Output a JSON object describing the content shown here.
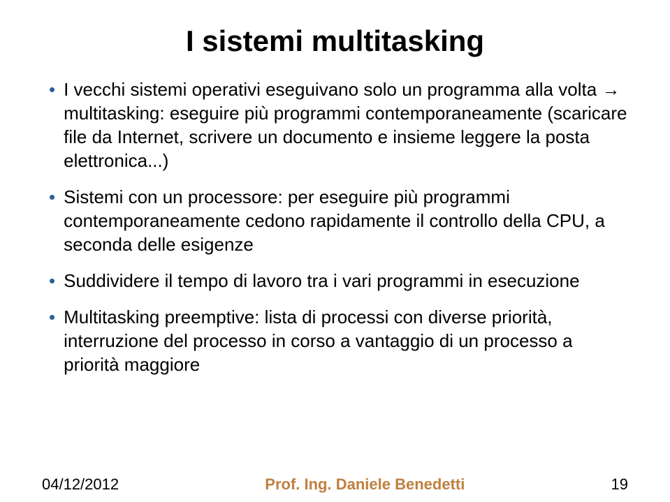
{
  "title": "I sistemi multitasking",
  "bullets": [
    "I vecchi sistemi operativi eseguivano solo un programma alla volta → multitasking: eseguire più programmi contemporaneamente (scaricare file da Internet, scrivere un documento e insieme leggere la posta elettronica...)",
    "Sistemi con un processore: per eseguire più programmi contemporaneamente cedono rapidamente il controllo della CPU, a seconda delle esigenze",
    "Suddividere il tempo di lavoro tra i vari programmi in esecuzione",
    "Multitasking preemptive: lista di processi con diverse priorità, interruzione del processo in corso a vantaggio di un processo a priorità maggiore"
  ],
  "footer": {
    "date": "04/12/2012",
    "author": "Prof. Ing. Daniele Benedetti",
    "page": "19"
  }
}
